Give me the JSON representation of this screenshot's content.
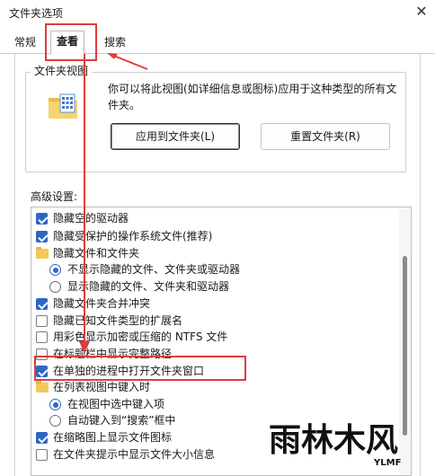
{
  "window": {
    "title": "文件夹选项"
  },
  "tabs": [
    {
      "label": "常规"
    },
    {
      "label": "查看"
    },
    {
      "label": "搜索"
    }
  ],
  "folder_views": {
    "legend": "文件夹视图",
    "description": "你可以将此视图(如详细信息或图标)应用于这种类型的所有文件夹。",
    "apply_button": "应用到文件夹(L)",
    "reset_button": "重置文件夹(R)"
  },
  "advanced": {
    "label": "高级设置:",
    "items": [
      {
        "kind": "checkbox",
        "checked": true,
        "label": "隐藏空的驱动器"
      },
      {
        "kind": "checkbox",
        "checked": true,
        "label": "隐藏受保护的操作系统文件(推荐)"
      },
      {
        "kind": "folder",
        "label": "隐藏文件和文件夹"
      },
      {
        "kind": "radio",
        "selected": true,
        "label": "不显示隐藏的文件、文件夹或驱动器"
      },
      {
        "kind": "radio",
        "selected": false,
        "label": "显示隐藏的文件、文件夹和驱动器"
      },
      {
        "kind": "checkbox",
        "checked": true,
        "label": "隐藏文件夹合并冲突"
      },
      {
        "kind": "checkbox",
        "checked": false,
        "label": "隐藏已知文件类型的扩展名"
      },
      {
        "kind": "checkbox",
        "checked": false,
        "label": "用彩色显示加密或压缩的 NTFS 文件"
      },
      {
        "kind": "checkbox",
        "checked": false,
        "label": "在标题栏中显示完整路径"
      },
      {
        "kind": "checkbox",
        "checked": true,
        "label": "在单独的进程中打开文件夹窗口"
      },
      {
        "kind": "folder",
        "label": "在列表视图中键入时"
      },
      {
        "kind": "radio",
        "selected": true,
        "label": "在视图中选中键入项"
      },
      {
        "kind": "radio",
        "selected": false,
        "label": "自动键入到“搜索”框中"
      },
      {
        "kind": "checkbox",
        "checked": true,
        "label": "在缩略图上显示文件图标"
      },
      {
        "kind": "checkbox",
        "checked": false,
        "label": "在文件夹提示中显示文件大小信息"
      }
    ]
  },
  "watermark": {
    "text": "雨林木风",
    "sub": "YLMF"
  },
  "colors": {
    "accent": "#2f66c3",
    "annotation": "#e23b3b"
  }
}
